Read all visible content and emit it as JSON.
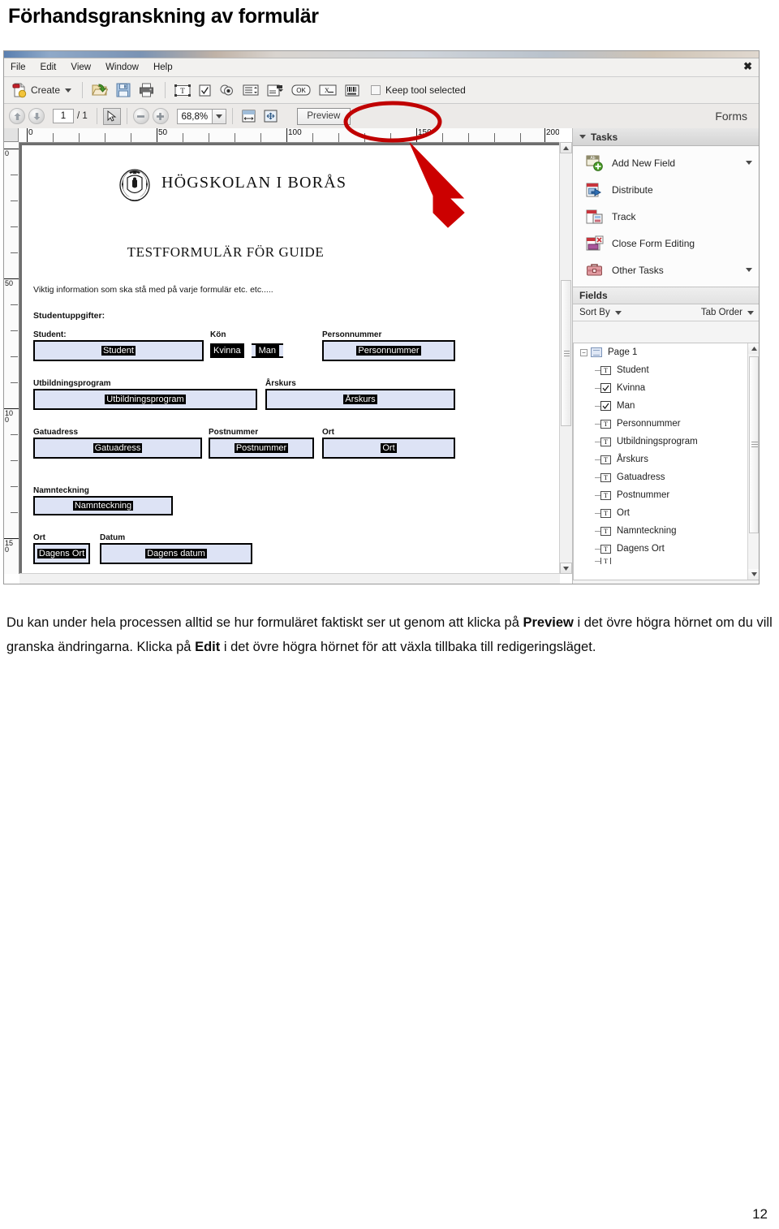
{
  "heading": "Förhandsgranskning av formulär",
  "app": {
    "menubar": {
      "items": [
        "File",
        "Edit",
        "View",
        "Window",
        "Help"
      ],
      "close_label": "✖"
    },
    "toolbar": {
      "create_label": "Create",
      "icons": [
        "new-document-icon",
        "open-folder-icon",
        "save-icon",
        "print-icon",
        "text-field-icon",
        "checkbox-field-icon",
        "radio-button-field-icon",
        "list-box-field-icon",
        "dropdown-field-icon",
        "push-button-field-icon",
        "signature-field-icon",
        "barcode-field-icon"
      ],
      "keep_tool_label": "Keep tool selected",
      "keep_tool_checked": false
    },
    "navbar": {
      "page_current": "1",
      "page_total": "/ 1",
      "zoom_value": "68,8%",
      "preview_label": "Preview",
      "panel_title": "Forms",
      "icons": [
        "previous-page-icon",
        "next-page-icon",
        "select-tool-icon",
        "zoom-out-icon",
        "zoom-in-icon",
        "fit-width-icon",
        "fit-page-icon"
      ]
    },
    "rulers": {
      "horizontal_labels": [
        "0",
        "50",
        "100",
        "150",
        "200"
      ],
      "vertical_labels": [
        "0",
        "50",
        "100",
        "150"
      ]
    },
    "document": {
      "university": "HÖGSKOLAN I BORÅS",
      "title": "TESTFORMULÄR FÖR GUIDE",
      "info": "Viktig information som ska stå med på varje formulär etc. etc.....",
      "section": "Studentuppgifter:",
      "fields": [
        {
          "label": "Student:",
          "value": "Student",
          "type": "text"
        },
        {
          "label": "Kön",
          "value": "",
          "type": "group"
        },
        {
          "label": "Personnummer",
          "value": "Personnummer",
          "type": "text"
        },
        {
          "label": "Utbildningsprogram",
          "value": "Utbildningsprogram",
          "type": "text"
        },
        {
          "label": "Årskurs",
          "value": "Årskurs",
          "type": "text"
        },
        {
          "label": "Gatuadress",
          "value": "Gatuadress",
          "type": "text"
        },
        {
          "label": "Postnummer",
          "value": "Postnummer",
          "type": "text"
        },
        {
          "label": "Ort",
          "value": "Ort",
          "type": "text"
        },
        {
          "label": "Namnteckning",
          "value": "Namnteckning",
          "type": "text"
        },
        {
          "label": "Ort",
          "value": "Dagens Ort",
          "type": "text"
        },
        {
          "label": "Datum",
          "value": "Dagens datum",
          "type": "text"
        }
      ],
      "checkboxes": [
        {
          "label": "Kvinna",
          "checked": false
        },
        {
          "label": "Man",
          "checked": true
        }
      ]
    },
    "panel": {
      "tasks_title": "Tasks",
      "tasks": [
        {
          "label": "Add New Field",
          "icon": "add-new-field-icon",
          "has_caret": true
        },
        {
          "label": "Distribute",
          "icon": "distribute-icon",
          "has_caret": false
        },
        {
          "label": "Track",
          "icon": "track-icon",
          "has_caret": false
        },
        {
          "label": "Close Form Editing",
          "icon": "close-form-editing-icon",
          "has_caret": false
        },
        {
          "label": "Other Tasks",
          "icon": "other-tasks-icon",
          "has_caret": true
        }
      ],
      "fields_title": "Fields",
      "sort_by_label": "Sort By",
      "tab_order_label": "Tab Order",
      "tree_root": "Page 1",
      "tree_items": [
        {
          "label": "Student",
          "type": "text"
        },
        {
          "label": "Kvinna",
          "type": "checkbox"
        },
        {
          "label": "Man",
          "type": "checkbox"
        },
        {
          "label": "Personnummer",
          "type": "text"
        },
        {
          "label": "Utbildningsprogram",
          "type": "text"
        },
        {
          "label": "Årskurs",
          "type": "text"
        },
        {
          "label": "Gatuadress",
          "type": "text"
        },
        {
          "label": "Postnummer",
          "type": "text"
        },
        {
          "label": "Ort",
          "type": "text"
        },
        {
          "label": "Namnteckning",
          "type": "text"
        },
        {
          "label": "Dagens Ort",
          "type": "text"
        }
      ]
    }
  },
  "caption": {
    "line1_a": "Du kan under hela processen alltid se hur formuläret faktiskt ser ut genom att klicka på ",
    "bold1": "Preview",
    "line1_b": " i det övre högra hörnet om du vill granska ändringarna. Klicka på ",
    "bold2": "Edit",
    "line1_c": " i det övre högra hörnet för att växla tillbaka till redigeringsläget."
  },
  "page_number": "12",
  "colors": {
    "annotation_red": "#c00000",
    "field_fill": "#dde3f5",
    "panel_bg": "#f4f4f4"
  }
}
